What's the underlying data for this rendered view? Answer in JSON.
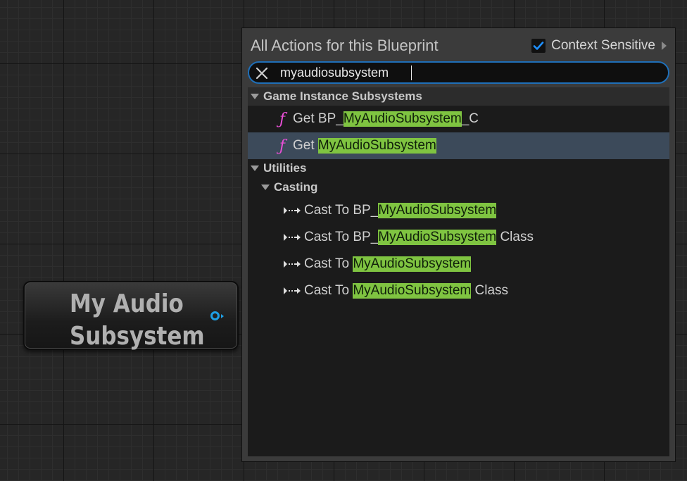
{
  "node": {
    "title": "My Audio Subsystem"
  },
  "menu": {
    "title": "All Actions for this Blueprint",
    "context_sensitive_label": "Context Sensitive",
    "context_sensitive_checked": true,
    "search": {
      "value": "myaudiosubsystem",
      "placeholder": ""
    },
    "categories": [
      {
        "label": "Game Instance Subsystems",
        "items": [
          {
            "icon": "function-icon",
            "pre": "Get BP_",
            "match": "MyAudioSubsystem",
            "post": "_C",
            "selected": false
          },
          {
            "icon": "function-icon",
            "pre": "Get ",
            "match": "MyAudioSubsystem",
            "post": "",
            "selected": true
          }
        ]
      },
      {
        "label": "Utilities",
        "subcategory": "Casting",
        "items": [
          {
            "icon": "cast-exec-icon",
            "pre": "Cast To BP_",
            "match": "MyAudioSubsystem",
            "post": ""
          },
          {
            "icon": "cast-exec-icon",
            "pre": "Cast To BP_",
            "match": "MyAudioSubsystem",
            "post": " Class"
          },
          {
            "icon": "cast-exec-icon",
            "pre": "Cast To ",
            "match": "MyAudioSubsystem",
            "post": ""
          },
          {
            "icon": "cast-exec-icon",
            "pre": "Cast To ",
            "match": "MyAudioSubsystem",
            "post": " Class"
          }
        ]
      }
    ]
  },
  "colors": {
    "highlight": "#7fc441",
    "selection": "#3c4a5a",
    "function_icon": "#e94fd6",
    "search_border": "#1f6fb8",
    "pin": "#1ea0e6"
  }
}
